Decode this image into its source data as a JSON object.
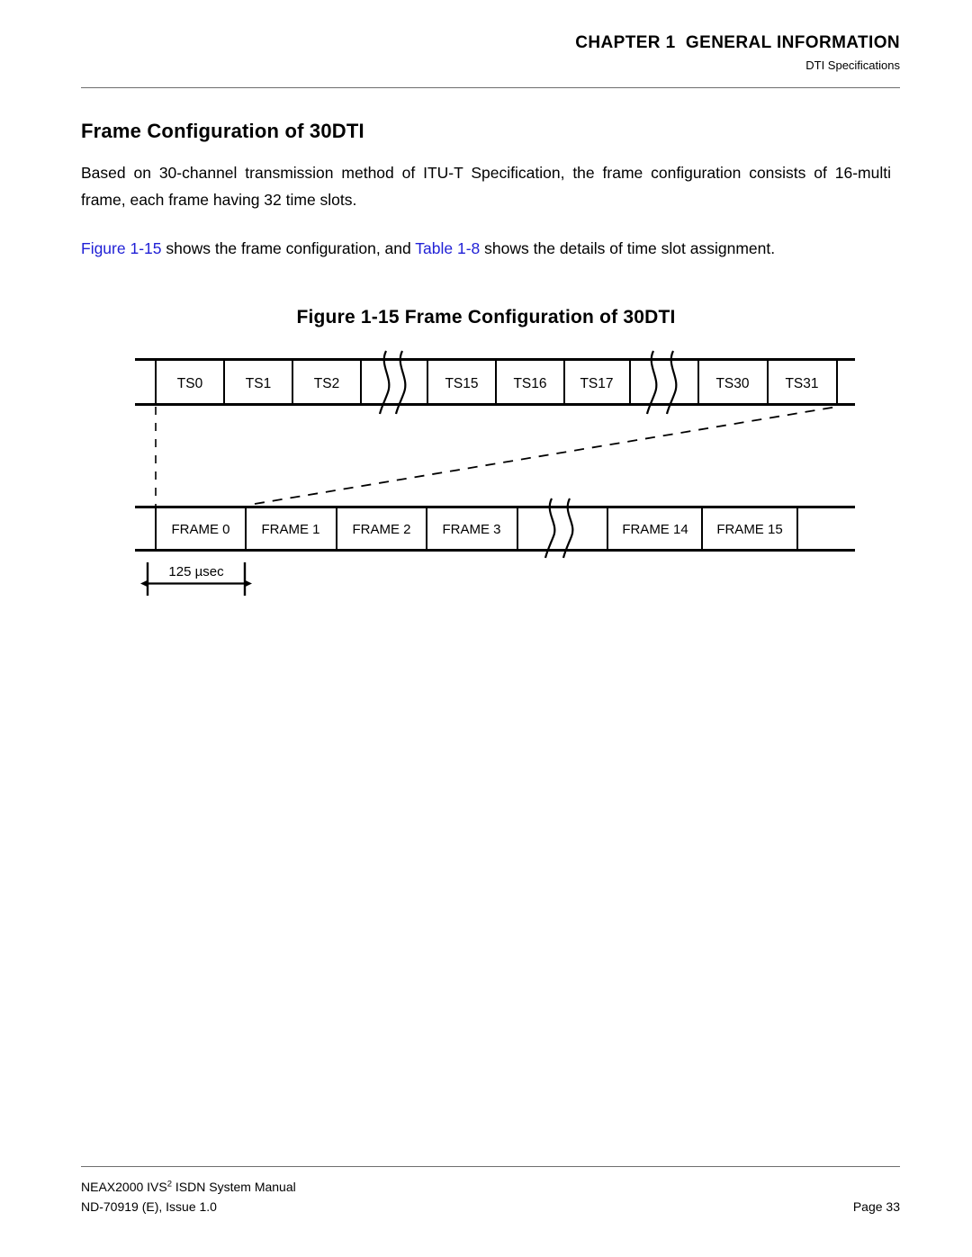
{
  "header": {
    "chapter": "CHAPTER 1  GENERAL INFORMATION",
    "subtitle": "DTI Specifications"
  },
  "section": {
    "title": "Frame Configuration of 30DTI",
    "paragraph_1_part_1": "Based on 30-channel transmission method of ITU-T Specification, the frame configuration consists of 16-multi frame, each frame having 32 time slots.",
    "paragraph_2": {
      "xref_figure": "Figure 1-15",
      "text_mid_1": " shows the frame configuration, and ",
      "xref_table": "Table 1-8",
      "text_mid_2": " shows the details of time slot assignment."
    }
  },
  "figure": {
    "caption": "Figure 1-15  Frame Configuration of 30DTI",
    "timeslot_row": {
      "label_prefix": "TS",
      "cells": [
        "TS0",
        "TS1",
        "TS2",
        "",
        "TS15",
        "TS16",
        "TS17",
        "",
        "TS30",
        "TS31"
      ]
    },
    "frame_row": {
      "label_prefix": "FRAME",
      "cells": [
        "FRAME 0",
        "FRAME 1",
        "FRAME 2",
        "FRAME 3",
        "",
        "FRAME 14",
        "FRAME 15"
      ]
    },
    "dimension": {
      "label": "125 µsec"
    }
  },
  "footer": {
    "manual_line_1_pre": "NEAX2000 IVS",
    "manual_line_1_sup": "2",
    "manual_line_1_post": " ISDN System Manual",
    "manual_line_2": "ND-70919 (E), Issue 1.0",
    "page": "Page 33"
  },
  "colors": {
    "text": "#000000",
    "xref": "#2121d6",
    "rule": "#6e6e6e"
  }
}
